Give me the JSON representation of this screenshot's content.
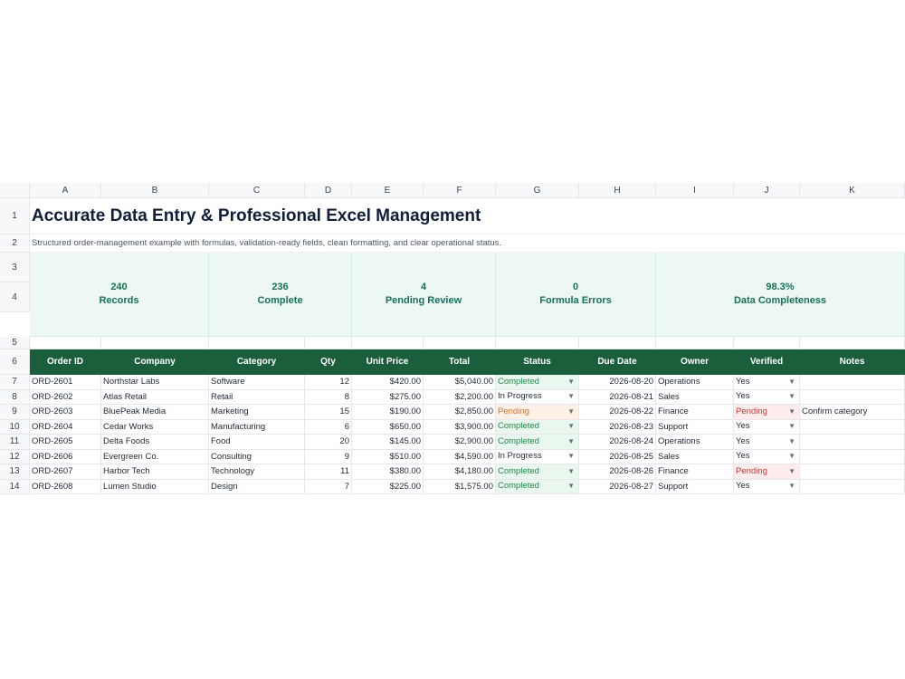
{
  "columns": [
    "A",
    "B",
    "C",
    "D",
    "E",
    "F",
    "G",
    "H",
    "I",
    "J",
    "K"
  ],
  "title": "Accurate Data Entry & Professional Excel Management",
  "subtitle": "Structured order-management example with formulas, validation-ready fields, clean formatting, and clear operational status.",
  "kpis": [
    {
      "value": "240",
      "label": "Records"
    },
    {
      "value": "236",
      "label": "Complete"
    },
    {
      "value": "4",
      "label": "Pending Review"
    },
    {
      "value": "0",
      "label": "Formula Errors"
    },
    {
      "value": "98.3%",
      "label": "Data Completeness"
    }
  ],
  "table_headers": [
    "Order ID",
    "Company",
    "Category",
    "Qty",
    "Unit Price",
    "Total",
    "Status",
    "Due Date",
    "Owner",
    "Verified",
    "Notes"
  ],
  "rows": [
    {
      "n": "7",
      "id": "ORD-2601",
      "company": "Northstar Labs",
      "category": "Software",
      "qty": "12",
      "price": "$420.00",
      "total": "$5,040.00",
      "status": "Completed",
      "due": "2026-08-20",
      "owner": "Operations",
      "verified": "Yes",
      "notes": ""
    },
    {
      "n": "8",
      "id": "ORD-2602",
      "company": "Atlas Retail",
      "category": "Retail",
      "qty": "8",
      "price": "$275.00",
      "total": "$2,200.00",
      "status": "In Progress",
      "due": "2026-08-21",
      "owner": "Sales",
      "verified": "Yes",
      "notes": ""
    },
    {
      "n": "9",
      "id": "ORD-2603",
      "company": "BluePeak Media",
      "category": "Marketing",
      "qty": "15",
      "price": "$190.00",
      "total": "$2,850.00",
      "status": "Pending",
      "due": "2026-08-22",
      "owner": "Finance",
      "verified": "Pending",
      "notes": "Confirm category"
    },
    {
      "n": "10",
      "id": "ORD-2604",
      "company": "Cedar Works",
      "category": "Manufacturing",
      "qty": "6",
      "price": "$650.00",
      "total": "$3,900.00",
      "status": "Completed",
      "due": "2026-08-23",
      "owner": "Support",
      "verified": "Yes",
      "notes": ""
    },
    {
      "n": "11",
      "id": "ORD-2605",
      "company": "Delta Foods",
      "category": "Food",
      "qty": "20",
      "price": "$145.00",
      "total": "$2,900.00",
      "status": "Completed",
      "due": "2026-08-24",
      "owner": "Operations",
      "verified": "Yes",
      "notes": ""
    },
    {
      "n": "12",
      "id": "ORD-2606",
      "company": "Evergreen Co.",
      "category": "Consulting",
      "qty": "9",
      "price": "$510.00",
      "total": "$4,590.00",
      "status": "In Progress",
      "due": "2026-08-25",
      "owner": "Sales",
      "verified": "Yes",
      "notes": ""
    },
    {
      "n": "13",
      "id": "ORD-2607",
      "company": "Harbor Tech",
      "category": "Technology",
      "qty": "11",
      "price": "$380.00",
      "total": "$4,180.00",
      "status": "Completed",
      "due": "2026-08-26",
      "owner": "Finance",
      "verified": "Pending",
      "notes": ""
    },
    {
      "n": "14",
      "id": "ORD-2608",
      "company": "Lumen Studio",
      "category": "Design",
      "qty": "7",
      "price": "$225.00",
      "total": "$1,575.00",
      "status": "Completed",
      "due": "2026-08-27",
      "owner": "Support",
      "verified": "Yes",
      "notes": ""
    }
  ],
  "dropdown_icon": "chevron-down-icon",
  "colors": {
    "header_bg": "#1b5e3b",
    "kpi_bg": "#ecf8f1",
    "kpi_text": "#17715a",
    "completed": "#1f8a4c",
    "pending": "#d9732a",
    "verified_pending": "#c23b3b"
  }
}
